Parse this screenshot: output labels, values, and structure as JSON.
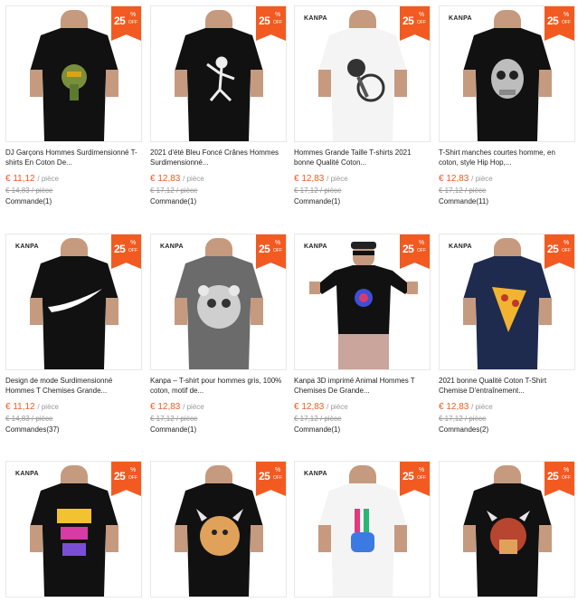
{
  "badge": {
    "value": "25",
    "percent": "%",
    "off": "OFF"
  },
  "price_unit": "/ pièce",
  "products": [
    {
      "brand": "",
      "title": "DJ Garçons Hommes Surdimensionné T-shirts En Coton De...",
      "price": "€ 11,12",
      "old_price": "€ 14,83 / pièce",
      "orders": "Commande(1)",
      "shirt_color": "#111111",
      "graphic": "zombie-dj"
    },
    {
      "brand": "",
      "title": "2021 d'été Bleu Foncé Crânes Hommes Surdimensionné...",
      "price": "€ 12,83",
      "old_price": "€ 17,12 / pièce",
      "orders": "Commande(1)",
      "shirt_color": "#111111",
      "graphic": "dabbing-skeleton"
    },
    {
      "brand": "KANPA",
      "title": "Hommes Grande Taille T-shirts 2021 bonne Qualité Coton...",
      "price": "€ 12,83",
      "old_price": "€ 17,12 / pièce",
      "orders": "Commande(1)",
      "shirt_color": "#f4f4f4",
      "graphic": "skeleton-bicycle"
    },
    {
      "brand": "KANPA",
      "title": "T-Shirt manches courtes homme, en coton, style Hip Hop,...",
      "price": "€ 12,83",
      "old_price": "€ 17,12 / pièce",
      "orders": "Commande(11)",
      "shirt_color": "#111111",
      "graphic": "skull"
    },
    {
      "brand": "KANPA",
      "title": "Design de mode Surdimensionné Hommes T Chemises Grande...",
      "price": "€ 11,12",
      "old_price": "€ 14,83 / pièce",
      "orders": "Commandes(37)",
      "shirt_color": "#111111",
      "graphic": "swoosh"
    },
    {
      "brand": "KANPA",
      "title": "Kanpa – T-shirt pour hommes gris, 100% coton, motif de...",
      "price": "€ 12,83",
      "old_price": "€ 17,12 / pièce",
      "orders": "Commande(1)",
      "shirt_color": "#6b6b6b",
      "graphic": "skull-flowers"
    },
    {
      "brand": "KANPA",
      "title": "Kanpa 3D imprimé Animal Hommes T Chemises De Grande...",
      "price": "€ 12,83",
      "old_price": "€ 17,12 / pièce",
      "orders": "Commande(1)",
      "shirt_color": "#111111",
      "graphic": "animal-print"
    },
    {
      "brand": "KANPA",
      "title": "2021 bonne Qualité Coton T-Shirt Chemise D'entraînement...",
      "price": "€ 12,83",
      "old_price": "€ 17,12 / pièce",
      "orders": "Commandes(2)",
      "shirt_color": "#1f2a4f",
      "graphic": "pizza-slice"
    },
    {
      "brand": "KANPA",
      "title": "",
      "price": "",
      "old_price": "",
      "orders": "",
      "shirt_color": "#111111",
      "graphic": "just-do-it"
    },
    {
      "brand": "",
      "title": "",
      "price": "",
      "old_price": "",
      "orders": "",
      "shirt_color": "#111111",
      "graphic": "viking"
    },
    {
      "brand": "KANPA",
      "title": "",
      "price": "",
      "old_price": "",
      "orders": "",
      "shirt_color": "#f4f4f4",
      "graphic": "peace-hand"
    },
    {
      "brand": "",
      "title": "",
      "price": "",
      "old_price": "",
      "orders": "",
      "shirt_color": "#111111",
      "graphic": "viking-warrior"
    }
  ]
}
